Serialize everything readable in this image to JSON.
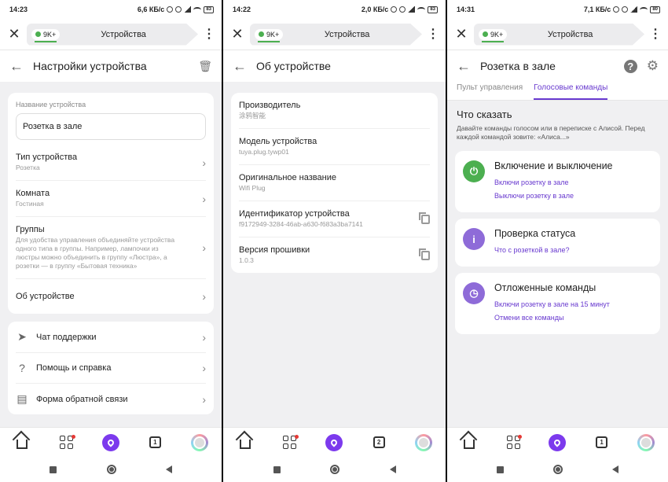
{
  "screens": [
    {
      "status": {
        "time": "14:23",
        "speed": "6,6 КБ/с",
        "battery": "83"
      },
      "browser": {
        "pill": "9K+",
        "title": "Устройства"
      },
      "header": {
        "title": "Настройки устройства"
      },
      "name_section": {
        "label": "Название устройства",
        "value": "Розетка в зале"
      },
      "rows": [
        {
          "title": "Тип устройства",
          "sub": "Розетка"
        },
        {
          "title": "Комната",
          "sub": "Гостиная"
        },
        {
          "title": "Группы",
          "sub": "Для удобства управления объединяйте устройства одного типа в группы. Например, лампочки из люстры можно объединить в группу «Люстра», а розетки — в группу «Бытовая техника»"
        },
        {
          "title": "Об устройстве",
          "sub": ""
        }
      ],
      "menu": [
        {
          "label": "Чат поддержки",
          "icon": "send-icon"
        },
        {
          "label": "Помощь и справка",
          "icon": "help-icon"
        },
        {
          "label": "Форма обратной связи",
          "icon": "feedback-icon"
        }
      ],
      "nav": {
        "tabs_count": "1"
      }
    },
    {
      "status": {
        "time": "14:22",
        "speed": "2,0 КБ/с",
        "battery": "83"
      },
      "browser": {
        "pill": "9K+",
        "title": "Устройства"
      },
      "header": {
        "title": "Об устройстве"
      },
      "rows": [
        {
          "title": "Производитель",
          "sub": "涂鸦智能"
        },
        {
          "title": "Модель устройства",
          "sub": "tuya.plug.tywp01"
        },
        {
          "title": "Оригинальное название",
          "sub": "Wifi Plug"
        },
        {
          "title": "Идентификатор устройства",
          "sub": "f9172949-3284-46ab-a630-f683a3ba7141",
          "copy": true
        },
        {
          "title": "Версия прошивки",
          "sub": "1.0.3",
          "copy": true
        }
      ],
      "nav": {
        "tabs_count": "2"
      }
    },
    {
      "status": {
        "time": "14:31",
        "speed": "7,1 КБ/с",
        "battery": "80"
      },
      "browser": {
        "pill": "9K+",
        "title": "Устройства"
      },
      "header": {
        "title": "Розетка в зале"
      },
      "tabs": [
        {
          "label": "Пульт управления"
        },
        {
          "label": "Голосовые команды"
        }
      ],
      "say": {
        "title": "Что сказать",
        "text": "Давайте команды голосом или в переписке с Алисой. Перед каждой командой зовите: «Алиса...»"
      },
      "commands": [
        {
          "title": "Включение и выключение",
          "icon": "power-icon",
          "color": "#4caf50",
          "examples": [
            "Включи розетку в зале",
            "Выключи розетку в зале"
          ]
        },
        {
          "title": "Проверка статуса",
          "icon": "info-icon",
          "color": "#8e6bd8",
          "examples": [
            "Что с розеткой в зале?"
          ]
        },
        {
          "title": "Отложенные команды",
          "icon": "clock-icon",
          "color": "#8e6bd8",
          "examples": [
            "Включи розетку в зале на 15 минут",
            "Отмени все команды"
          ]
        }
      ],
      "nav": {
        "tabs_count": "1"
      }
    }
  ]
}
